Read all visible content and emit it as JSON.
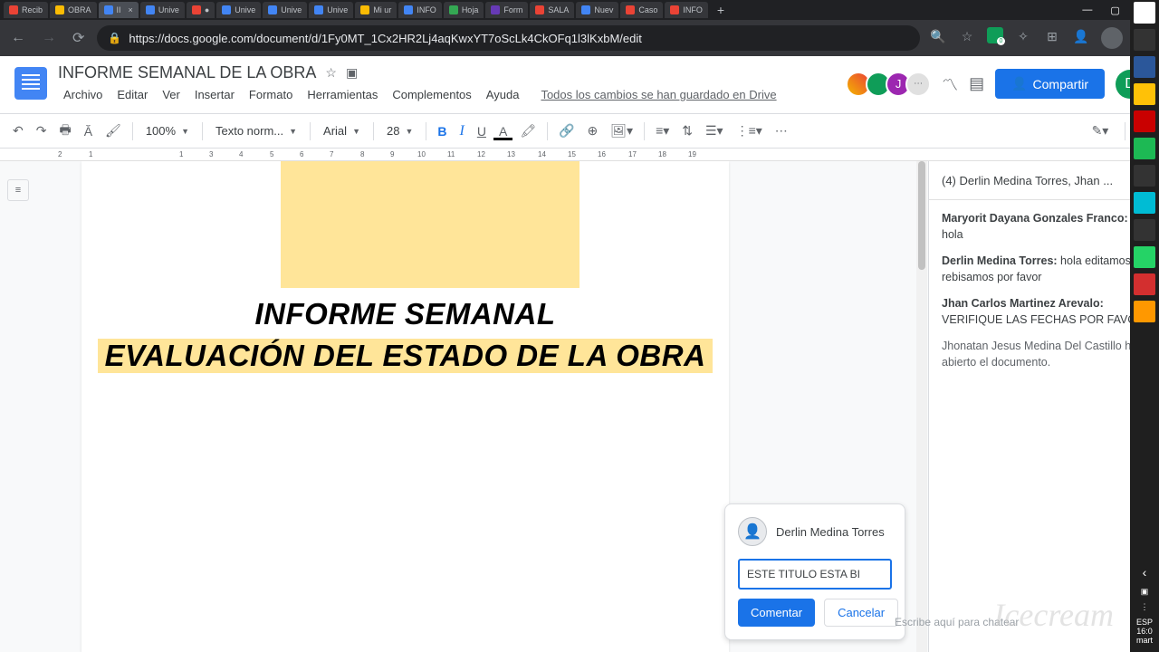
{
  "browser": {
    "tabs": [
      "Recib",
      "OBRA",
      "II",
      "Unive",
      "●",
      "Unive",
      "Unive",
      "Unive",
      "Mi ur",
      "INFO",
      "Hoja",
      "Form",
      "SALA",
      "Nuev",
      "Caso",
      "INFO"
    ],
    "url": "https://docs.google.com/document/d/1Fy0MT_1Cx2HR2Lj4aqKwxYT7oScLk4CkOFq1l3lKxbM/edit"
  },
  "docs": {
    "title": "INFORME SEMANAL DE LA OBRA",
    "menus": [
      "Archivo",
      "Editar",
      "Ver",
      "Insertar",
      "Formato",
      "Herramientas",
      "Complementos",
      "Ayuda"
    ],
    "saveStatus": "Todos los cambios se han guardado en Drive",
    "share": "Compartir",
    "userInitial": "D",
    "collabJ": "J"
  },
  "toolbar": {
    "zoom": "100%",
    "style": "Texto norm...",
    "font": "Arial",
    "fontSize": "28"
  },
  "document": {
    "line1": "INFORME SEMANAL",
    "line2": "EVALUACIÓN DEL ESTADO DE LA OBRA"
  },
  "comment": {
    "author": "Derlin Medina Torres",
    "text": "ESTE TITULO ESTA BI",
    "submit": "Comentar",
    "cancel": "Cancelar"
  },
  "sidePanel": {
    "title": "(4) Derlin Medina Torres, Jhan ...",
    "messages": [
      {
        "name": "Maryorit Dayana Gonzales Franco:",
        "text": " hola"
      },
      {
        "name": "Derlin Medina Torres:",
        "text": " hola editamos y rebisamos por favor"
      },
      {
        "name": "Jhan Carlos Martinez Arevalo:",
        "text": " VERIFIQUE LAS FECHAS POR FAVOR"
      },
      {
        "name": "",
        "text": "Jhonatan Jesus Medina Del Castillo ha abierto el documento."
      }
    ],
    "chatHint": "Escribe aquí para chatear"
  },
  "winFooter": {
    "lang": "ESP",
    "time": "16:0",
    "date": "mart"
  }
}
